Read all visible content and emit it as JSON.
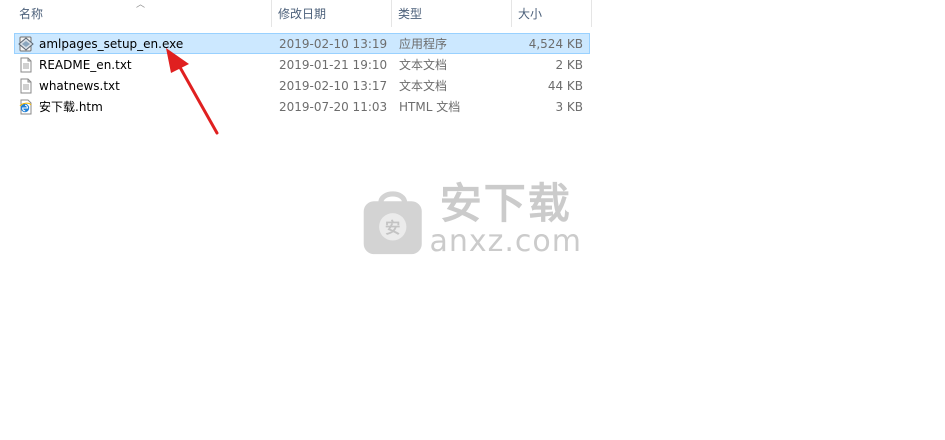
{
  "columns": {
    "name": "名称",
    "date": "修改日期",
    "type": "类型",
    "size": "大小"
  },
  "files": [
    {
      "name": "amlpages_setup_en.exe",
      "date": "2019-02-10 13:19",
      "type": "应用程序",
      "size": "4,524 KB",
      "icon": "installer-icon",
      "selected": true
    },
    {
      "name": "README_en.txt",
      "date": "2019-01-21 19:10",
      "type": "文本文档",
      "size": "2 KB",
      "icon": "text-document-icon",
      "selected": false
    },
    {
      "name": "whatnews.txt",
      "date": "2019-02-10 13:17",
      "type": "文本文档",
      "size": "44 KB",
      "icon": "text-document-icon",
      "selected": false
    },
    {
      "name": "安下载.htm",
      "date": "2019-07-20 11:03",
      "type": "HTML 文档",
      "size": "3 KB",
      "icon": "html-document-icon",
      "selected": false
    }
  ],
  "watermark": {
    "chinese": "安下载",
    "domain": "anxz.com",
    "badge_char": "安"
  },
  "colors": {
    "selection_bg": "#cce8ff",
    "selection_border": "#99d1ff",
    "header_text": "#4c607a",
    "arrow": "#e02020"
  }
}
